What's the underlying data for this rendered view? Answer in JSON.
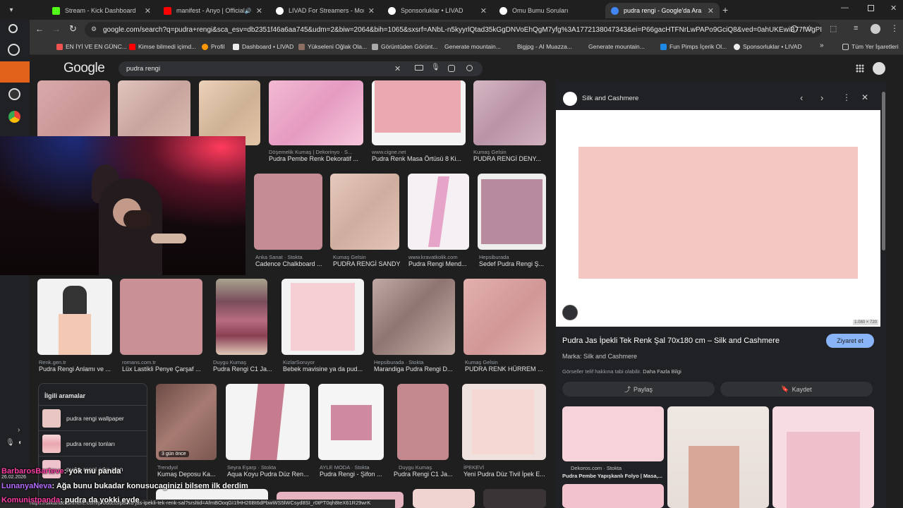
{
  "tabs": [
    {
      "title": "Stream - Kick Dashboard",
      "color": "#53fc18"
    },
    {
      "title": "manifest - Anyo | Official M",
      "color": "#ff0000"
    },
    {
      "title": "LIVAD For Streamers - Monetiz",
      "color": "#ffffff"
    },
    {
      "title": "Sponsorluklar • LIVAD",
      "color": "#ffffff"
    },
    {
      "title": "Omu Bumu Soruları",
      "color": "#ffffff"
    },
    {
      "title": "pudra rengi - Google'da Ara",
      "color": "#4285f4"
    }
  ],
  "url": "google.com/search?q=pudra+rengi&sca_esv=db2351f46a6aa745&udm=2&biw=2064&bih=1065&sxsrf=ANbL-n5kyyrlQtad35kGgDNVoEhQgM7yfg%3A1772138047343&ei=P66gacHTFNrLwPAPo9GciQ8&ved=0ahUKEwiB77fWgPISAx...",
  "bookmarks": [
    "EN İYİ VE EN GÜNC...",
    "Kimse bilmedi içimd...",
    "Profil",
    "Dashboard • LIVAD",
    "Yükseleni Oğlak Ola...",
    "Görüntüden Görünt...",
    "Generate mountain...",
    "Bigjpg - AI Muazza...",
    "Generate mountain...",
    "Fun Pimps İçerik Ol...",
    "Sponsorluklar • LIVAD"
  ],
  "bookmarks_all": "Tüm Yer İşaretleri",
  "google": {
    "logo": "Google",
    "query": "pudra rengi"
  },
  "grid": [
    {
      "src": "Döşemelik Kumaş | Dekorinyo · S...",
      "cap": "Pudra Pembe Renk Dekoratif ..."
    },
    {
      "src": "www.cigne.net",
      "cap": "Pudra Renk Masa Örtüsü 8 Ki..."
    },
    {
      "src": "Kumaş Gelsin",
      "cap": "PUDRA RENGİ DENY..."
    },
    {
      "src": "Anka Sanat · Stokta",
      "cap": "Cadence Chalkboard ..."
    },
    {
      "src": "Kumaş Gelsin",
      "cap": "PUDRA RENGİ SANDY"
    },
    {
      "src": "www.kravatkolik.com",
      "cap": "Pudra Rengi Mend..."
    },
    {
      "src": "Hepsiburada",
      "cap": "Sedef Pudra Rengi Ş..."
    },
    {
      "src": "Renk.gen.tr",
      "cap": "Pudra Rengi Anlamı ve ..."
    },
    {
      "src": "romans.com.tr",
      "cap": "Lüx Lastikli Penye Çarşaf ..."
    },
    {
      "src": "Duygu Kumaş",
      "cap": "Pudra Rengi C1 Ja..."
    },
    {
      "src": "KizlarSoruyor",
      "cap": "Bebek mavisine ya da pud..."
    },
    {
      "src": "Hepsiburada · Stokta",
      "cap": "Marandiga Pudra Rengi D..."
    },
    {
      "src": "Kumaş Gelsin",
      "cap": "PUDRA RENK HÜRREM ..."
    },
    {
      "src": "Trendyol",
      "cap": "Kumaş Deposu Ka..."
    },
    {
      "src": "Seyra Eşarp · Stokta",
      "cap": "Aqua Koyu Pudra Düz Ren..."
    },
    {
      "src": "AYLE MODA · Stokta",
      "cap": "Pudra Rengi - Şifon ..."
    },
    {
      "src": "Duygu Kumaş",
      "cap": "Pudra Rengi C1 Ja..."
    },
    {
      "src": "İPEKEVİ",
      "cap": "Yeni Pudra Düz Tivil İpek E..."
    }
  ],
  "badge_3gun": "3 gün önce",
  "related": {
    "title": "İlgili aramalar",
    "items": [
      "pudra rengi wallpaper",
      "pudra rengi tonları",
      "pudra rengi arka plan"
    ]
  },
  "panel": {
    "site": "Silk and Cashmere",
    "dims": "1.080 × 720",
    "title": "Pudra Jas İpekli Tek Renk Şal 70x180 cm – Silk and Cashmere",
    "visit": "Ziyaret et",
    "brand": "Marka: Silk and Cashmere",
    "copyright": "Görseller telif hakkına tabi olabilir.",
    "more_info": "Daha Fazla Bilgi",
    "share": "Paylaş",
    "save": "Kaydet",
    "related_src": "Dekoros.com · Stokta",
    "related_cap": "Pudra Pembe Yapışkanlı Folyo | Masa,..."
  },
  "status_url": "https://silkandcashmere.com/products/pudra-jas-ipekli-tek-renk-sal?srsltid=AfmBOoqGI1fHH26Bt6dPbwWS5lWCsyd8SI_r0tPT0qh8teX61R29wrK",
  "overlay": {
    "date": "26.02.2026",
    "chat": [
      {
        "user": "BarbarosBarteve",
        "msg": ": yok mu panda",
        "color": "#ff3ea5"
      },
      {
        "user": "LunanyaNeva",
        "msg": ": Ağa bunu bukadar konusucaginizi bilsem ilk derdim",
        "color": "#b46cff"
      },
      {
        "user": "Komunistpanda",
        "msg": ": pudra da yokki eyde",
        "color": "#ff3ea5"
      }
    ]
  }
}
